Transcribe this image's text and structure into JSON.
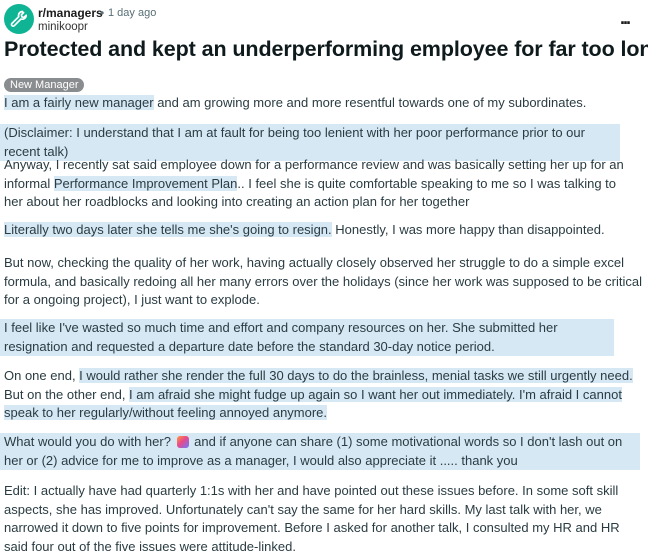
{
  "post": {
    "subreddit": "r/managers",
    "separator": "•",
    "time_ago": "1 day ago",
    "username": "minikoopr",
    "more_label": "...",
    "title": "Protected and kept an underperforming employee for far too long",
    "flair": "New Manager"
  },
  "body": {
    "p1_a": "I am a fairly new manager",
    "p1_b": " and am growing more and more resentful towards one of my subordinates.",
    "p2": "(Disclaimer: I understand that I am at fault for being too lenient with her poor performance prior to our recent talk)",
    "p3_a": "Anyway, I recently sat said employee down for a performance review and was basically setting her up for an informal ",
    "p3_link": "Performance Improvement Plan",
    "p3_b": ".. I feel she is quite comfortable speaking to me so I was talking to her about her roadblocks and looking into creating an action plan for her together",
    "p4_a": "Literally two days later she tells me she's going to resign.",
    "p4_b": " Honestly, I was more happy than disappointed.",
    "p5": "But now, checking the quality of her work, having actually closely observed her struggle to do a simple excel formula, and basically redoing all her many errors over the holidays (since her work was supposed to be critical for a ongoing project), I just want to explode.",
    "p6": "I feel like I've wasted so much time and effort and company resources on her. She submitted her resignation and requested a departure date before the standard 30-day notice period.",
    "p7_a": "On one end, ",
    "p7_b": "I would rather she render the full 30 days to do the brainless, menial tasks we still urgently need.",
    "p7_c": " But on the other end, ",
    "p7_d": "I am afraid she might fudge up again so I want her out immediately. I'm afraid I cannot speak to her regularly/without feeling annoyed anymore.",
    "p8_a": "What would you do with her? ",
    "p8_b": " and if anyone can share (1) some motivational words so I don't lash out on her or (2) advice for me to improve as a manager, I would also appreciate it ..... thank you",
    "p9": "Edit: I actually have had quarterly 1:1s with her and have pointed out these issues before. In some soft skill aspects, she has improved. Unfortunately can't say the same for her hard skills. My last talk with her, we narrowed it down to five points for improvement. Before I asked for another talk, I consulted my HR and HR said four out of the five issues were attitude-linked."
  }
}
